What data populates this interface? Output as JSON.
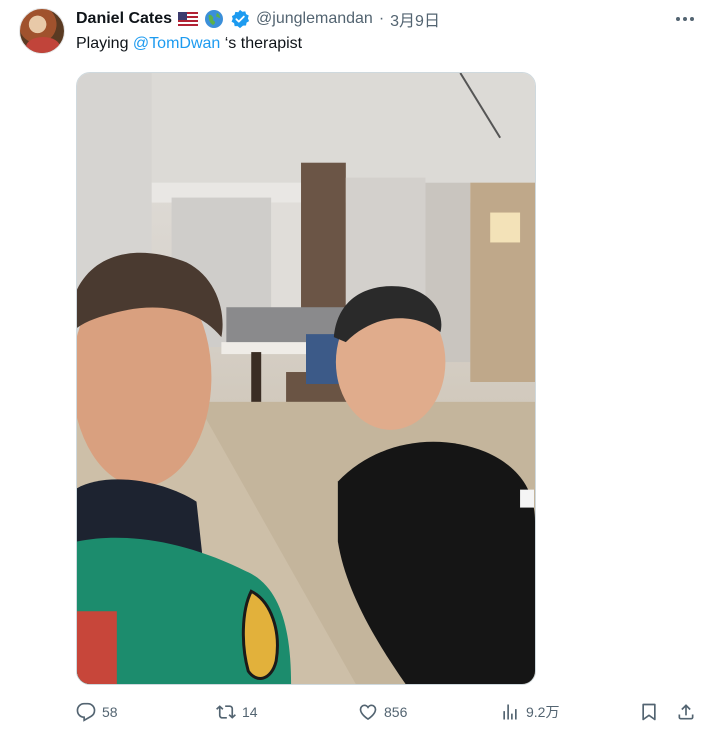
{
  "tweet": {
    "author_name": "Daniel Cates",
    "handle": "@junglemandan",
    "separator": "·",
    "date": "3月9日",
    "text_prefix": "Playing ",
    "mention": "@TomDwan",
    "text_suffix": " ‘s therapist"
  },
  "actions": {
    "replies": "58",
    "retweets": "14",
    "likes": "856",
    "views": "9.2万"
  },
  "colors": {
    "accent": "#1d9bf0",
    "secondary_text": "#536471",
    "border": "#cfd9de"
  },
  "icons": [
    "flag-us-icon",
    "globe-icon",
    "verified-badge-icon",
    "more-icon",
    "reply-icon",
    "retweet-icon",
    "like-icon",
    "views-icon",
    "bookmark-icon",
    "share-icon"
  ]
}
